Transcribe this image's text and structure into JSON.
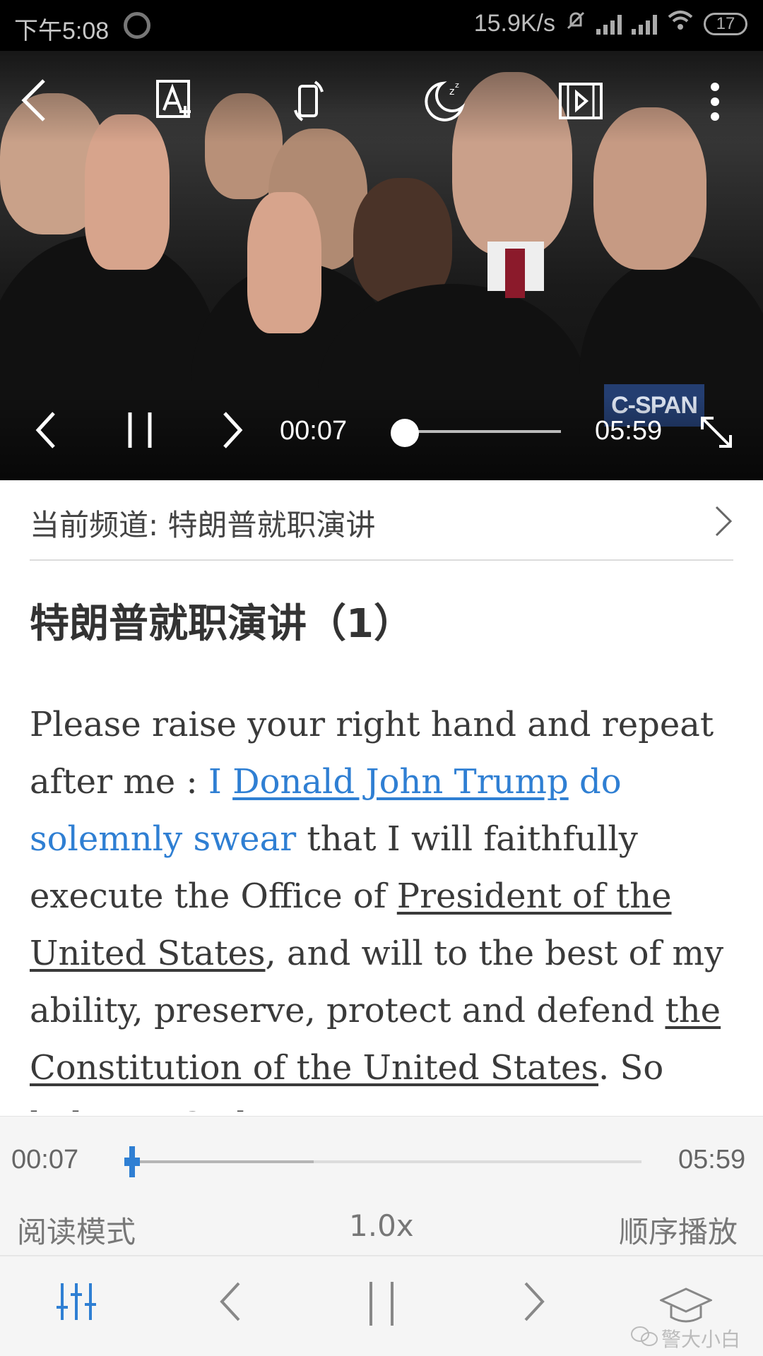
{
  "status_bar": {
    "time": "下午5:08",
    "net_speed": "15.9K/s",
    "battery": "17"
  },
  "video": {
    "current_time": "00:07",
    "duration": "05:59",
    "progress": 0.02,
    "logo": "C-SPAN",
    "top_icons": [
      "back-icon",
      "font-size-icon",
      "phone-rotate-icon",
      "sleep-timer-icon",
      "video-list-icon",
      "more-icon"
    ],
    "bottom_icons": [
      "previous-icon",
      "pause-icon",
      "next-icon",
      "fullscreen-icon"
    ]
  },
  "channel": {
    "label": "当前频道: 特朗普就职演讲"
  },
  "lesson": {
    "title": "特朗普就职演讲（1）"
  },
  "passage": {
    "segments": [
      {
        "text": "Please raise your right hand and repeat after me : ",
        "style": "plain"
      },
      {
        "text": "I ",
        "style": "highlight"
      },
      {
        "text": "Donald John Trump",
        "style": "highlight-underline"
      },
      {
        "text": " do solemnly swear",
        "style": "highlight"
      },
      {
        "text": " that I will faithfully execute the Office of ",
        "style": "plain"
      },
      {
        "text": "President of the United States",
        "style": "underline"
      },
      {
        "text": ", and will to the best of my ability, preserve, protect and defend ",
        "style": "plain"
      },
      {
        "text": "the Constitution of the United States",
        "style": "underline"
      },
      {
        "text": ". So help me God.",
        "style": "plain"
      }
    ]
  },
  "player": {
    "current_time": "00:07",
    "duration": "05:59",
    "progress": 0.01,
    "buffered": 0.36,
    "read_mode": "阅读模式",
    "speed": "1.0x",
    "play_order": "顺序播放",
    "icons": [
      "equalizer-icon",
      "previous-icon",
      "pause-icon",
      "next-icon",
      "graduation-cap-icon"
    ]
  },
  "watermark": "警大小白",
  "colors": {
    "accent": "#2f7fd3",
    "text": "#3a3a3a",
    "status_bar": "#000000"
  }
}
